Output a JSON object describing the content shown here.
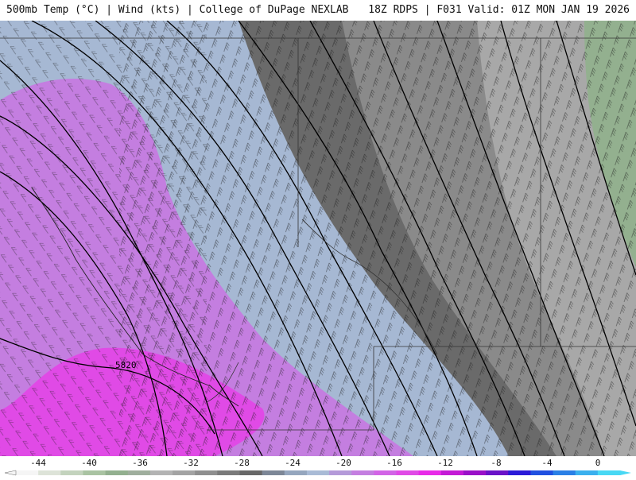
{
  "header": {
    "left_title": "500mb Temp (°C) | Wind (kts) | College of DuPage NEXLAB",
    "right_title": "18Z RDPS | F031 Valid: 01Z MON JAN 19 2026"
  },
  "map": {
    "height_label": "5820",
    "colors": {
      "magenta": "#e04ae6",
      "purple": "#c47ee0",
      "light_blue": "#a6b8d3",
      "blue_gray": "#8d9bb0",
      "dark_gray": "#6a6a6a",
      "mid_gray": "#8a8a8a",
      "light_gray": "#a8a8a8",
      "green": "#93b08f",
      "contour": "#000000"
    }
  },
  "legend": {
    "ticks": [
      "-44",
      "-40",
      "-36",
      "-32",
      "-28",
      "-24",
      "-20",
      "-16",
      "-12",
      "-8",
      "-4",
      "0"
    ],
    "colors": [
      "#f5f5f5",
      "#dde3d8",
      "#c3d3bd",
      "#a9c3a2",
      "#93b08f",
      "#9fae9d",
      "#b3b3b3",
      "#a3a3a3",
      "#8f8f8f",
      "#7a7a7a",
      "#686868",
      "#7d8797",
      "#95a6be",
      "#a9bbd6",
      "#b49ad9",
      "#c47ee0",
      "#d264e6",
      "#e04ae6",
      "#e82ae8",
      "#c41ad6",
      "#9a10c8",
      "#6a12c8",
      "#2a1ad8",
      "#2050e0",
      "#2a80e6",
      "#3ab0ee",
      "#48d8f4"
    ]
  }
}
